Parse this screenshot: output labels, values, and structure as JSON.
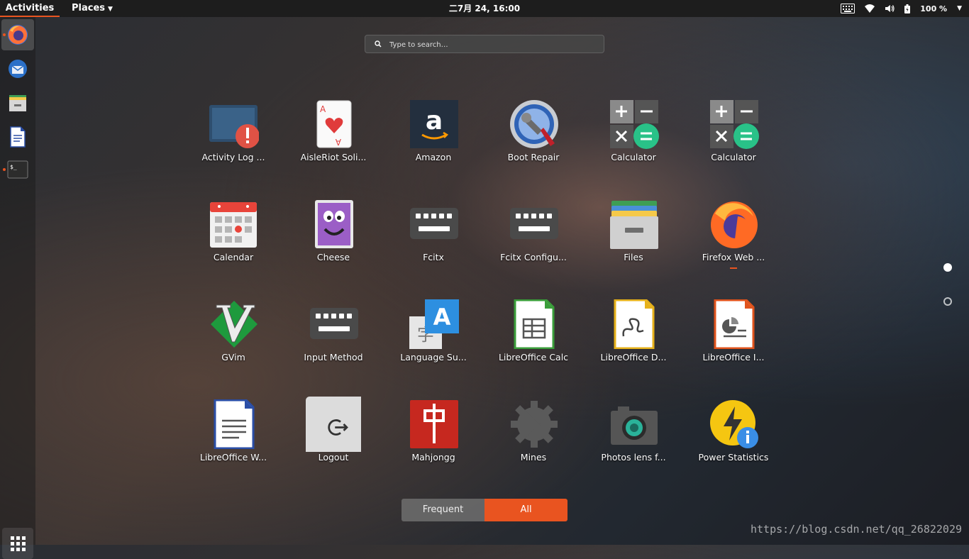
{
  "topbar": {
    "activities": "Activities",
    "places": "Places",
    "clock": "二7月 24, 16:00",
    "battery": "100 %"
  },
  "dock": {
    "items": [
      {
        "icon": "firefox-icon"
      },
      {
        "icon": "thunderbird-icon"
      },
      {
        "icon": "files-icon"
      },
      {
        "icon": "writer-icon"
      },
      {
        "icon": "terminal-icon"
      }
    ]
  },
  "search": {
    "placeholder": "Type to search…"
  },
  "apps": [
    {
      "label": "Activity Log ...",
      "icon": "activity-log-icon"
    },
    {
      "label": "AisleRiot Soli...",
      "icon": "aisleriot-icon"
    },
    {
      "label": "Amazon",
      "icon": "amazon-icon"
    },
    {
      "label": "Boot Repair",
      "icon": "boot-repair-icon"
    },
    {
      "label": "Calculator",
      "icon": "calculator-icon"
    },
    {
      "label": "Calculator",
      "icon": "calculator-icon"
    },
    {
      "label": "Calendar",
      "icon": "calendar-icon"
    },
    {
      "label": "Cheese",
      "icon": "cheese-icon"
    },
    {
      "label": "Fcitx",
      "icon": "keyboard-icon"
    },
    {
      "label": "Fcitx Configu...",
      "icon": "keyboard-icon"
    },
    {
      "label": "Files",
      "icon": "files-icon"
    },
    {
      "label": "Firefox Web ...",
      "icon": "firefox-icon"
    },
    {
      "label": "GVim",
      "icon": "gvim-icon"
    },
    {
      "label": "Input Method",
      "icon": "keyboard-icon"
    },
    {
      "label": "Language Su...",
      "icon": "language-icon"
    },
    {
      "label": "LibreOffice Calc",
      "icon": "libreoffice-calc-icon"
    },
    {
      "label": "LibreOffice D...",
      "icon": "libreoffice-draw-icon"
    },
    {
      "label": "LibreOffice I...",
      "icon": "libreoffice-impress-icon"
    },
    {
      "label": "LibreOffice W...",
      "icon": "libreoffice-writer-icon"
    },
    {
      "label": "Logout",
      "icon": "logout-icon"
    },
    {
      "label": "Mahjongg",
      "icon": "mahjongg-icon"
    },
    {
      "label": "Mines",
      "icon": "mines-icon"
    },
    {
      "label": "Photos lens f...",
      "icon": "camera-icon"
    },
    {
      "label": "Power Statistics",
      "icon": "power-statistics-icon"
    }
  ],
  "switcher": {
    "frequent": "Frequent",
    "all": "All"
  },
  "watermark": "https://blog.csdn.net/qq_26822029",
  "colors": {
    "accent": "#e95420",
    "topbar": "#1d1d1d"
  }
}
